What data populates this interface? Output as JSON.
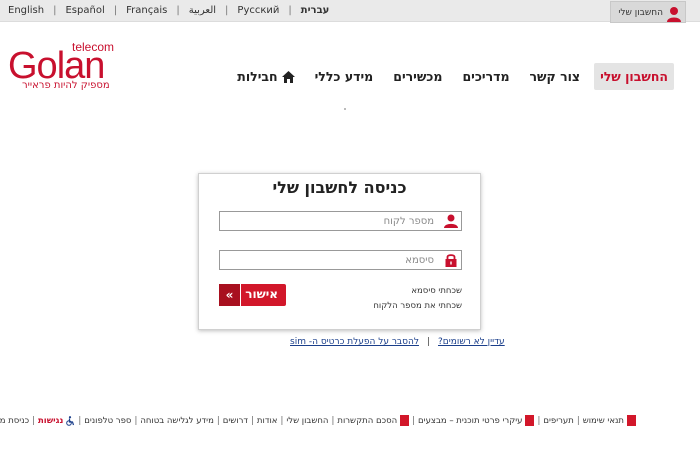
{
  "topbar": {
    "languages": [
      {
        "label": "English"
      },
      {
        "label": "Español"
      },
      {
        "label": "Français"
      },
      {
        "label": "العربية"
      },
      {
        "label": "Русский"
      },
      {
        "label": "עברית"
      }
    ],
    "account_label": "החשבון שלי"
  },
  "logo": {
    "brand": "Golan",
    "sub": "telecom",
    "slogan": "מספיק להיות פראייר"
  },
  "nav": {
    "items": [
      {
        "label": "חבילות",
        "icon": "home-icon"
      },
      {
        "label": "מידע כללי"
      },
      {
        "label": "מכשירים"
      },
      {
        "label": "מדריכים"
      },
      {
        "label": "צור קשר"
      },
      {
        "label": "החשבון שלי",
        "active": true
      }
    ]
  },
  "login": {
    "title": "כניסה לחשבון שלי",
    "customer_placeholder": "מספר לקוח",
    "password_placeholder": "סיסמא",
    "forgot_password": "שכחתי סיסמא",
    "forgot_customer": "שכחתי את מספר הלקוח",
    "submit_label": "אישור",
    "submit_arrows": "«"
  },
  "below": {
    "not_registered": "עדיין לא רשומים?",
    "sim_explain": "להסבר על הפעלת כרטיס ה- sim"
  },
  "footer": {
    "items": [
      {
        "label": "תנאי שימוש",
        "pdf": true
      },
      {
        "label": "תעריפים"
      },
      {
        "label": "עיקרי פרטי תוכנית – מבצעים",
        "pdf": true
      },
      {
        "label": "הסכם התקשרות",
        "pdf": true
      },
      {
        "label": "החשבון שלי"
      },
      {
        "label": "אודות"
      },
      {
        "label": "דרושים"
      },
      {
        "label": "מידע לגלישה בטוחה"
      },
      {
        "label": "ספר טלפונים"
      },
      {
        "label": "נגישות",
        "accessibility": true
      },
      {
        "label": "כניסת משווק"
      }
    ]
  },
  "colors": {
    "brand_red": "#c8102e",
    "link_blue": "#1a3e8a"
  }
}
